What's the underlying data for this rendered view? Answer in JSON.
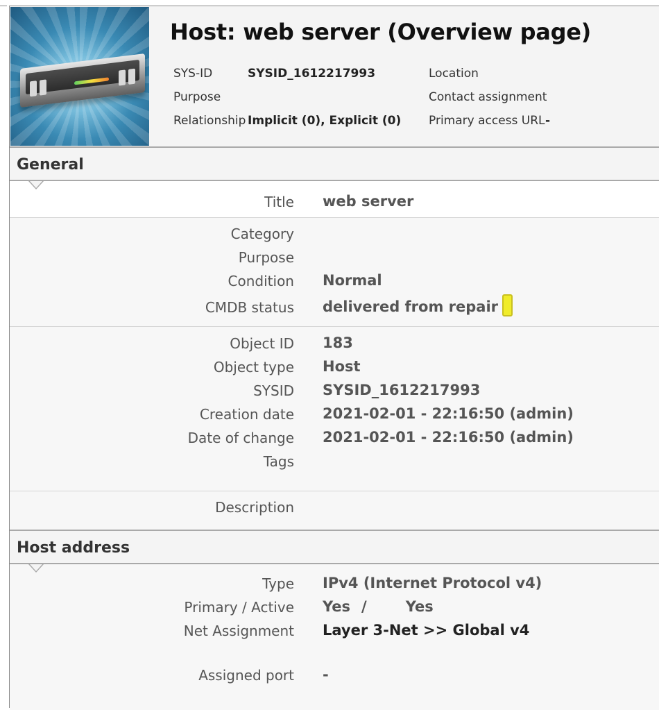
{
  "header": {
    "title": "Host: web server (Overview page)",
    "sysid_label": "SYS-ID",
    "sysid_value": "SYSID_1612217993",
    "purpose_label": "Purpose",
    "relationship_label": "Relationship",
    "relationship_value": "Implicit (0), Explicit (0)",
    "location_label": "Location",
    "contact_label": "Contact assignment",
    "access_url_label": "Primary access URL",
    "access_url_value": "-"
  },
  "general": {
    "heading": "General",
    "title_label": "Title",
    "title_value": "web server",
    "category_label": "Category",
    "purpose_label": "Purpose",
    "condition_label": "Condition",
    "condition_value": "Normal",
    "cmdb_label": "CMDB status",
    "cmdb_value": "delivered from repair",
    "cmdb_color": "#f0ec2a",
    "object_id_label": "Object ID",
    "object_id_value": "183",
    "object_type_label": "Object type",
    "object_type_value": "Host",
    "sysid_label": "SYSID",
    "sysid_value": "SYSID_1612217993",
    "creation_label": "Creation date",
    "creation_value": "2021-02-01 - 22:16:50 (admin)",
    "change_label": "Date of change",
    "change_value": "2021-02-01 - 22:16:50 (admin)",
    "tags_label": "Tags",
    "description_label": "Description"
  },
  "host_address": {
    "heading": "Host address",
    "type_label": "Type",
    "type_value": "IPv4 (Internet Protocol v4)",
    "primary_active_label": "Primary / Active",
    "primary_value": "Yes",
    "separator": "/",
    "active_value": "Yes",
    "net_label": "Net Assignment",
    "net_value": "Layer 3-Net >> Global v4",
    "port_label": "Assigned port",
    "port_value": "-"
  },
  "icons": {
    "object_image": "server-icon"
  }
}
